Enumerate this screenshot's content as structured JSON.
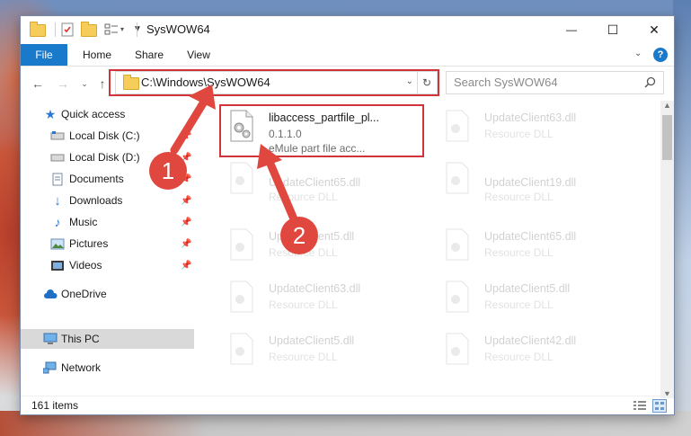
{
  "window": {
    "title": "SysWOW64",
    "controls": {
      "minimize": "—",
      "maximize": "☐",
      "close": "✕"
    }
  },
  "ribbon": {
    "tabs": [
      {
        "label": "File"
      },
      {
        "label": "Home"
      },
      {
        "label": "Share"
      },
      {
        "label": "View"
      }
    ]
  },
  "address": {
    "path": "C:\\Windows\\SysWOW64",
    "search_placeholder": "Search SysWOW64"
  },
  "navigation": {
    "items": [
      {
        "label": "Quick access",
        "icon": "star-icon"
      },
      {
        "label": "Local Disk (C:)",
        "icon": "drive-icon"
      },
      {
        "label": "Local Disk (D:)",
        "icon": "drive-icon"
      },
      {
        "label": "Documents",
        "icon": "documents-icon"
      },
      {
        "label": "Downloads",
        "icon": "download-icon"
      },
      {
        "label": "Music",
        "icon": "music-icon"
      },
      {
        "label": "Pictures",
        "icon": "pictures-icon"
      },
      {
        "label": "Videos",
        "icon": "videos-icon"
      },
      {
        "label": "OneDrive",
        "icon": "cloud-icon"
      },
      {
        "label": "This PC",
        "icon": "computer-icon"
      },
      {
        "label": "Network",
        "icon": "network-icon"
      }
    ]
  },
  "files": {
    "highlighted": {
      "name": "libaccess_partfile_pl...",
      "version": "0.1.1.0",
      "description": "eMule part file acc..."
    },
    "background": [
      {
        "name": "UpdateClient63.dll",
        "type": "Resource DLL"
      },
      {
        "name": "UpdateClient65.dll",
        "type": "Resource DLL"
      },
      {
        "name": "UpdateClient19.dll",
        "type": "Resource DLL"
      },
      {
        "name": "UpdateClient5.dll",
        "type": "Resource DLL"
      },
      {
        "name": "UpdateClient65.dll",
        "type": "Resource DLL"
      },
      {
        "name": "UpdateClient63.dll",
        "type": "Resource DLL"
      },
      {
        "name": "UpdateClient5.dll",
        "type": "Resource DLL"
      },
      {
        "name": "UpdateClient5.dll",
        "type": "Resource DLL"
      },
      {
        "name": "UpdateClient42.dll",
        "type": "Resource DLL"
      }
    ]
  },
  "status": {
    "item_count": "161 items"
  },
  "annotations": [
    {
      "number": "1"
    },
    {
      "number": "2"
    }
  ],
  "colors": {
    "accent": "#1979ca",
    "highlight": "#d0343a",
    "marker": "#e0483f"
  }
}
